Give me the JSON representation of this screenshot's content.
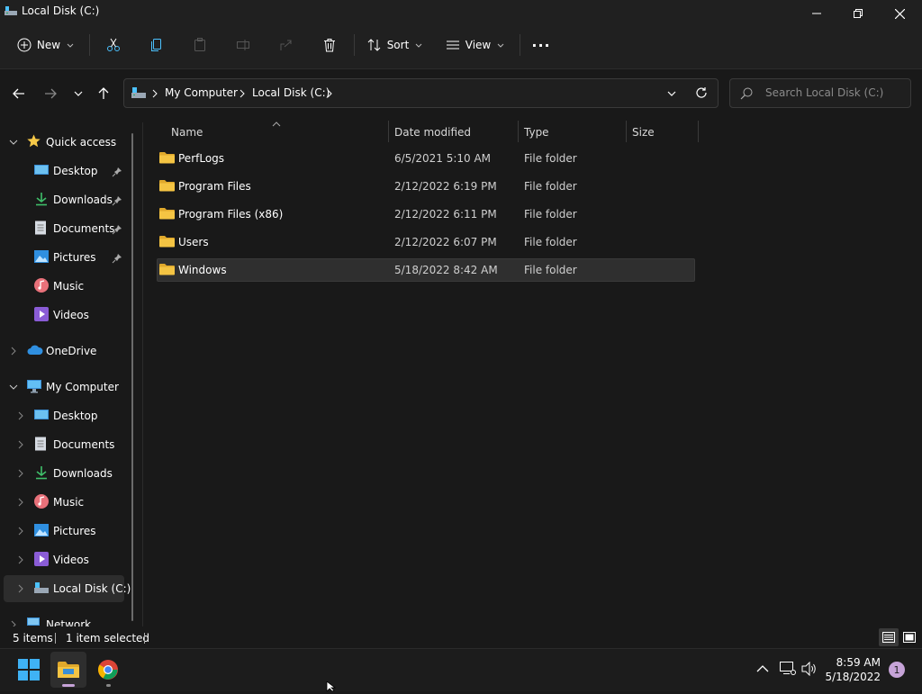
{
  "window": {
    "title": "Local Disk (C:)"
  },
  "toolbar": {
    "new_label": "New",
    "sort_label": "Sort",
    "view_label": "View",
    "more_label": "···"
  },
  "address": {
    "crumbs": [
      "My Computer",
      "Local Disk (C:)"
    ],
    "search_placeholder": "Search Local Disk (C:)"
  },
  "sidebar": {
    "quick_access": "Quick access",
    "quick_items": [
      "Desktop",
      "Downloads",
      "Documents",
      "Pictures",
      "Music",
      "Videos"
    ],
    "onedrive": "OneDrive",
    "my_computer": "My Computer",
    "computer_items": [
      "Desktop",
      "Documents",
      "Downloads",
      "Music",
      "Pictures",
      "Videos",
      "Local Disk (C:)"
    ],
    "network": "Network"
  },
  "columns": {
    "name": "Name",
    "date": "Date modified",
    "type": "Type",
    "size": "Size"
  },
  "files": [
    {
      "name": "PerfLogs",
      "date": "6/5/2021 5:10 AM",
      "type": "File folder"
    },
    {
      "name": "Program Files",
      "date": "2/12/2022 6:19 PM",
      "type": "File folder"
    },
    {
      "name": "Program Files (x86)",
      "date": "2/12/2022 6:11 PM",
      "type": "File folder"
    },
    {
      "name": "Users",
      "date": "2/12/2022 6:07 PM",
      "type": "File folder"
    },
    {
      "name": "Windows",
      "date": "5/18/2022 8:42 AM",
      "type": "File folder"
    }
  ],
  "status": {
    "count": "5 items",
    "selected": "1 item selected"
  },
  "clock": {
    "time": "8:59 AM",
    "date": "5/18/2022"
  },
  "notifications": {
    "count": "1"
  },
  "colors": {
    "accent": "#4cc2ff",
    "folder": "#f4c443",
    "selection": "#2f2f2f"
  }
}
